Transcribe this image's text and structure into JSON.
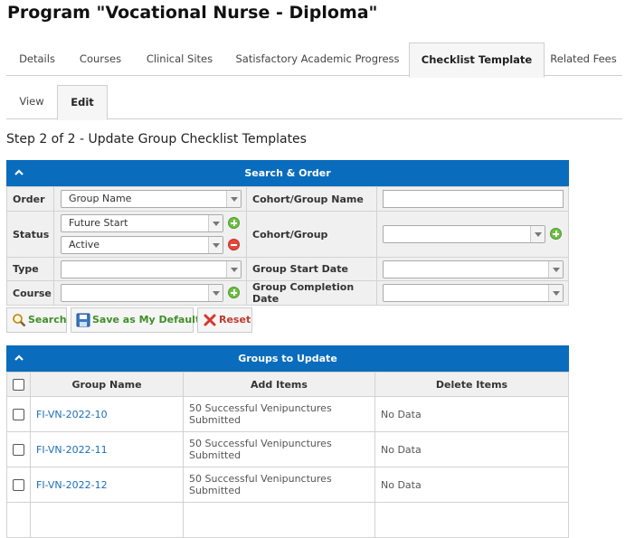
{
  "page": {
    "title": "Program \"Vocational Nurse - Diploma\""
  },
  "main_tabs": [
    {
      "label": "Details"
    },
    {
      "label": "Courses"
    },
    {
      "label": "Clinical Sites"
    },
    {
      "label": "Satisfactory Academic Progress"
    },
    {
      "label": "Checklist Template",
      "active": true
    },
    {
      "label": "Related Fees"
    }
  ],
  "sub_tabs": [
    {
      "label": "View"
    },
    {
      "label": "Edit",
      "active": true
    }
  ],
  "step_title": "Step 2 of 2 - Update Group Checklist Templates",
  "search_order": {
    "header": "Search & Order",
    "order_label": "Order",
    "order_value": "Group Name",
    "status_label": "Status",
    "status_values": [
      "Future Start",
      "Active"
    ],
    "type_label": "Type",
    "type_value": "",
    "course_label": "Course",
    "course_value": "",
    "cohort_name_label": "Cohort/Group Name",
    "cohort_name_value": "",
    "cohort_group_label": "Cohort/Group",
    "cohort_group_value": "",
    "start_date_label": "Group Start Date",
    "start_date_value": "",
    "completion_date_label": "Group Completion Date",
    "completion_date_value": ""
  },
  "buttons": {
    "search": "Search",
    "save_default": "Save as My Default",
    "reset": "Reset"
  },
  "groups": {
    "header": "Groups to Update",
    "columns": [
      "Group Name",
      "Add Items",
      "Delete Items"
    ],
    "rows": [
      {
        "name": "FI-VN-2022-10",
        "add_line1": "50 Successful Venipunctures",
        "add_line2": "Submitted",
        "delete": "No Data"
      },
      {
        "name": "FI-VN-2022-11",
        "add_line1": "50 Successful Venipunctures",
        "add_line2": "Submitted",
        "delete": "No Data"
      },
      {
        "name": "FI-VN-2022-12",
        "add_line1": "50 Successful Venipunctures",
        "add_line2": "Submitted",
        "delete": "No Data"
      },
      {
        "name": "",
        "add_line1": "",
        "add_line2": "",
        "delete": ""
      }
    ]
  },
  "colors": {
    "header_blue": "#0a6cbc",
    "link_blue": "#1b6fb5",
    "green": "#3f8f28",
    "red": "#c0392b"
  }
}
